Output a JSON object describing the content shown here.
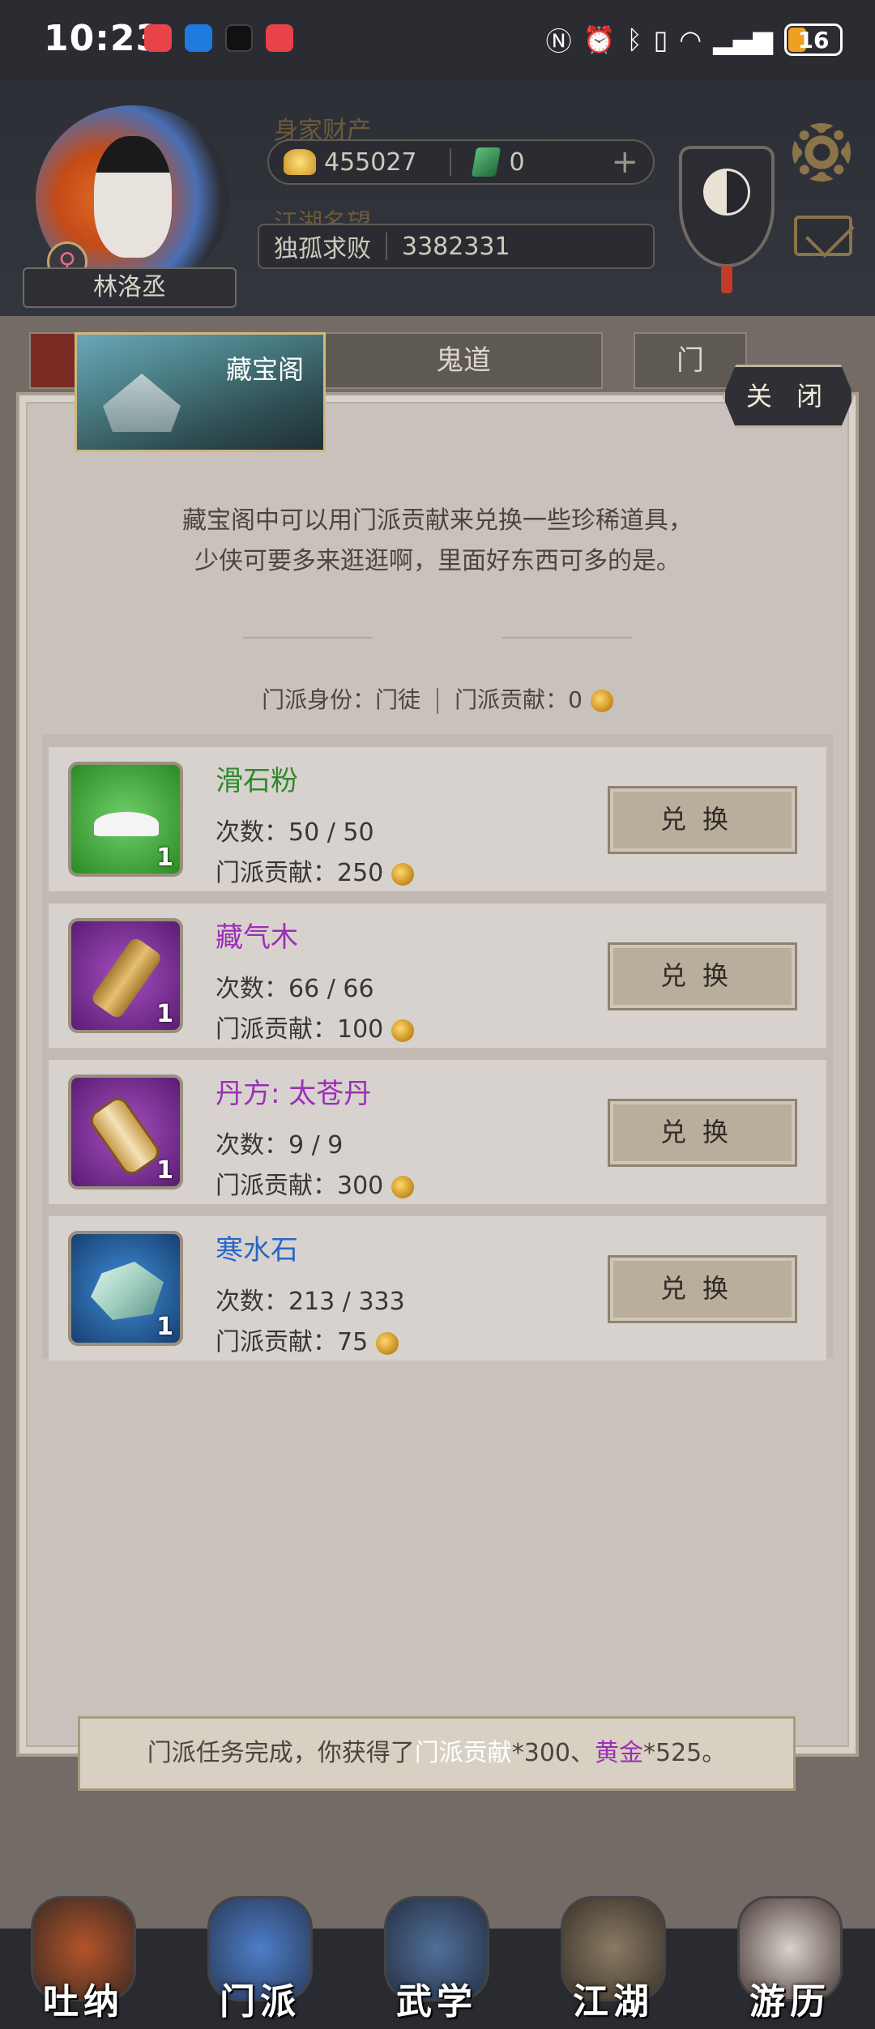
{
  "status_bar": {
    "time": "10:23",
    "battery": "16"
  },
  "header": {
    "player_name": "林洛丞",
    "gender_symbol": "♀",
    "wealth_label": "身家财产",
    "gold": "455027",
    "jade": "0",
    "plus": "+",
    "fame_label": "江湖名望",
    "fame_title": "独孤求败",
    "fame_value": "3382331"
  },
  "tabs": {
    "middle": "鬼道",
    "right": "门"
  },
  "dialog": {
    "title": "藏宝阁",
    "close_label": "关 闭",
    "intro_line1": "藏宝阁中可以用门派贡献来兑换一些珍稀道具，",
    "intro_line2": "少侠可要多来逛逛啊，里面好东西可多的是。",
    "identity_label": "门派身份：",
    "identity_value": "门徒",
    "contribution_label": "门派贡献：",
    "contribution_value": "0",
    "times_label": "次数：",
    "cost_label": "门派贡献："
  },
  "items": [
    {
      "name": "滑石粉",
      "times": "50 / 50",
      "cost": "250",
      "qty": "1",
      "button": "兑换",
      "color": "#2f8a2c"
    },
    {
      "name": "藏气木",
      "times": "66 / 66",
      "cost": "100",
      "qty": "1",
      "button": "兑换",
      "color": "#9b2fb5"
    },
    {
      "name": "丹方: 太苍丹",
      "times": "9 / 9",
      "cost": "300",
      "qty": "1",
      "button": "兑换",
      "color": "#9b2fb5"
    },
    {
      "name": "寒水石",
      "times": "213 / 333",
      "cost": "75",
      "qty": "1",
      "button": "兑换",
      "color": "#2867c9"
    }
  ],
  "toast": {
    "prefix": "门派任务完成，你获得了",
    "reward1": "门派贡献",
    "mid": "*300、",
    "reward2": "黄金",
    "suffix": "*525。"
  },
  "bottom_nav": [
    "吐纳",
    "门派",
    "武学",
    "江湖",
    "游历"
  ]
}
